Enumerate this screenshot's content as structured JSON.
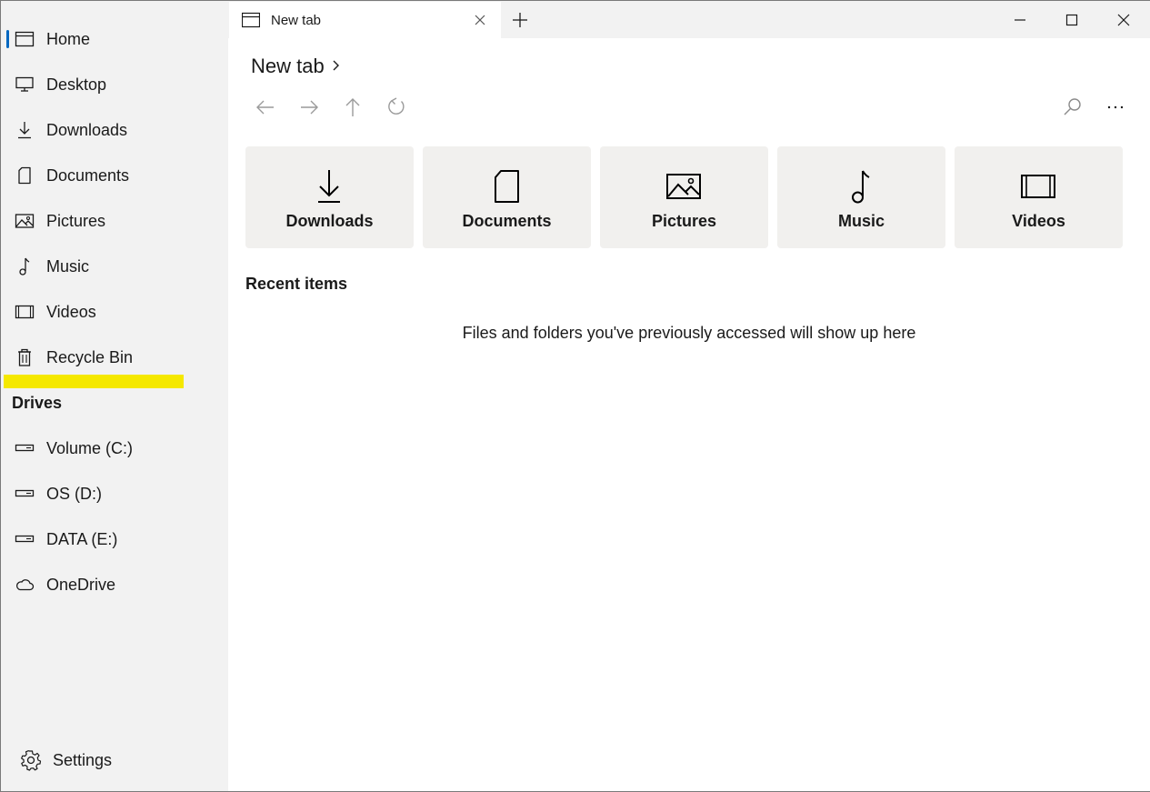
{
  "tab": {
    "title": "New tab"
  },
  "breadcrumb": {
    "title": "New tab"
  },
  "sidebar": {
    "items": [
      {
        "label": "Home",
        "icon": "home-icon"
      },
      {
        "label": "Desktop",
        "icon": "desktop-icon"
      },
      {
        "label": "Downloads",
        "icon": "download-icon"
      },
      {
        "label": "Documents",
        "icon": "document-icon"
      },
      {
        "label": "Pictures",
        "icon": "picture-icon"
      },
      {
        "label": "Music",
        "icon": "music-icon"
      },
      {
        "label": "Videos",
        "icon": "video-icon"
      },
      {
        "label": "Recycle Bin",
        "icon": "recycle-bin-icon"
      }
    ],
    "drives_header": "Drives",
    "drives": [
      {
        "label": "Volume (C:)",
        "icon": "drive-icon"
      },
      {
        "label": "OS (D:)",
        "icon": "drive-icon"
      },
      {
        "label": "DATA (E:)",
        "icon": "drive-icon"
      },
      {
        "label": "OneDrive",
        "icon": "cloud-icon"
      }
    ],
    "settings_label": "Settings"
  },
  "quick_access": [
    {
      "label": "Downloads",
      "icon": "download-icon"
    },
    {
      "label": "Documents",
      "icon": "document-icon"
    },
    {
      "label": "Pictures",
      "icon": "picture-icon"
    },
    {
      "label": "Music",
      "icon": "music-icon"
    },
    {
      "label": "Videos",
      "icon": "video-icon"
    }
  ],
  "recent": {
    "header": "Recent items",
    "empty_message": "Files and folders you've previously accessed will show up here"
  },
  "colors": {
    "accent": "#0067c0",
    "highlight": "#f5e800",
    "sidebar_bg": "#f2f2f2",
    "card_bg": "#f1f0ee"
  }
}
